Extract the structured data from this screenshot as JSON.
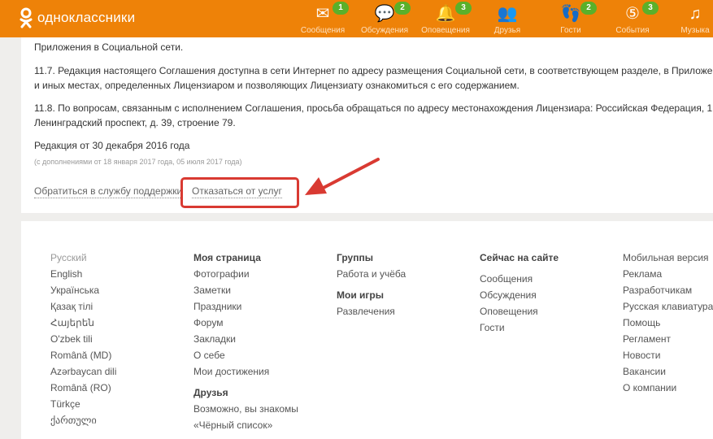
{
  "header": {
    "logo": "одноклассники",
    "nav": [
      {
        "label": "Сообщения",
        "icon": "envelope-icon",
        "badge": "1"
      },
      {
        "label": "Обсуждения",
        "icon": "chat-bubbles-icon",
        "badge": "2"
      },
      {
        "label": "Оповещения",
        "icon": "bell-icon",
        "badge": "3"
      },
      {
        "label": "Друзья",
        "icon": "friends-icon",
        "badge": null
      },
      {
        "label": "Гости",
        "icon": "footprints-icon",
        "badge": "2"
      },
      {
        "label": "События",
        "icon": "events-icon",
        "badge": "3"
      },
      {
        "label": "Музыка",
        "icon": "music-note-icon",
        "badge": null
      }
    ]
  },
  "content": {
    "line0": "Приложения в Социальной сети.",
    "p117a": "11.7. Редакция настоящего Соглашения доступна в сети Интернет по адресу размещения Социальной сети, в соответствующем разделе, в Приложе",
    "p117b": "и иных местах, определенных Лицензиаром и позволяющих Лицензиату ознакомиться с его содержанием.",
    "p118a": "11.8. По вопросам, связанным с исполнением Соглашения, просьба обращаться по адресу местонахождения Лицензиара: Российская Федерация, 1",
    "p118b": "Ленинградский проспект, д. 39, строение 79.",
    "edition": "Редакция от 30 декабря 2016 года",
    "amendments": "(с дополнениями от 18 января 2017 года, 05 июля 2017 года)",
    "support_link": "Обратиться в службу поддержки",
    "cancel_link": "Отказаться от услуг"
  },
  "footer": {
    "languages": [
      "Русский",
      "English",
      "Українська",
      "Қазақ тілі",
      "Հայերեն",
      "O'zbek tili",
      "Română (MD)",
      "Azərbaycan dili",
      "Română (RO)",
      "Türkçe",
      "ქართული"
    ],
    "my_page": {
      "title": "Моя страница",
      "items": [
        "Фотографии",
        "Заметки",
        "Праздники",
        "Форум",
        "Закладки",
        "О себе",
        "Мои достижения"
      ]
    },
    "friends": {
      "title": "Друзья",
      "items": [
        "Возможно, вы знакомы",
        "«Чёрный список»"
      ]
    },
    "groups": {
      "title": "Группы",
      "items": [
        "Работа и учёба"
      ]
    },
    "games": {
      "title": "Мои игры",
      "items": [
        "Развлечения"
      ]
    },
    "online": {
      "title": "Сейчас на сайте",
      "items": [
        "Сообщения",
        "Обсуждения",
        "Оповещения",
        "Гости"
      ]
    },
    "misc": [
      "Мобильная версия",
      "Реклама",
      "Разработчикам",
      "Русская клавиатура",
      "Помощь",
      "Регламент",
      "Новости",
      "Вакансии",
      "О компании"
    ]
  },
  "colors": {
    "brand": "#ee8208",
    "badge": "#5ab02a",
    "annotation": "#d93a32"
  }
}
